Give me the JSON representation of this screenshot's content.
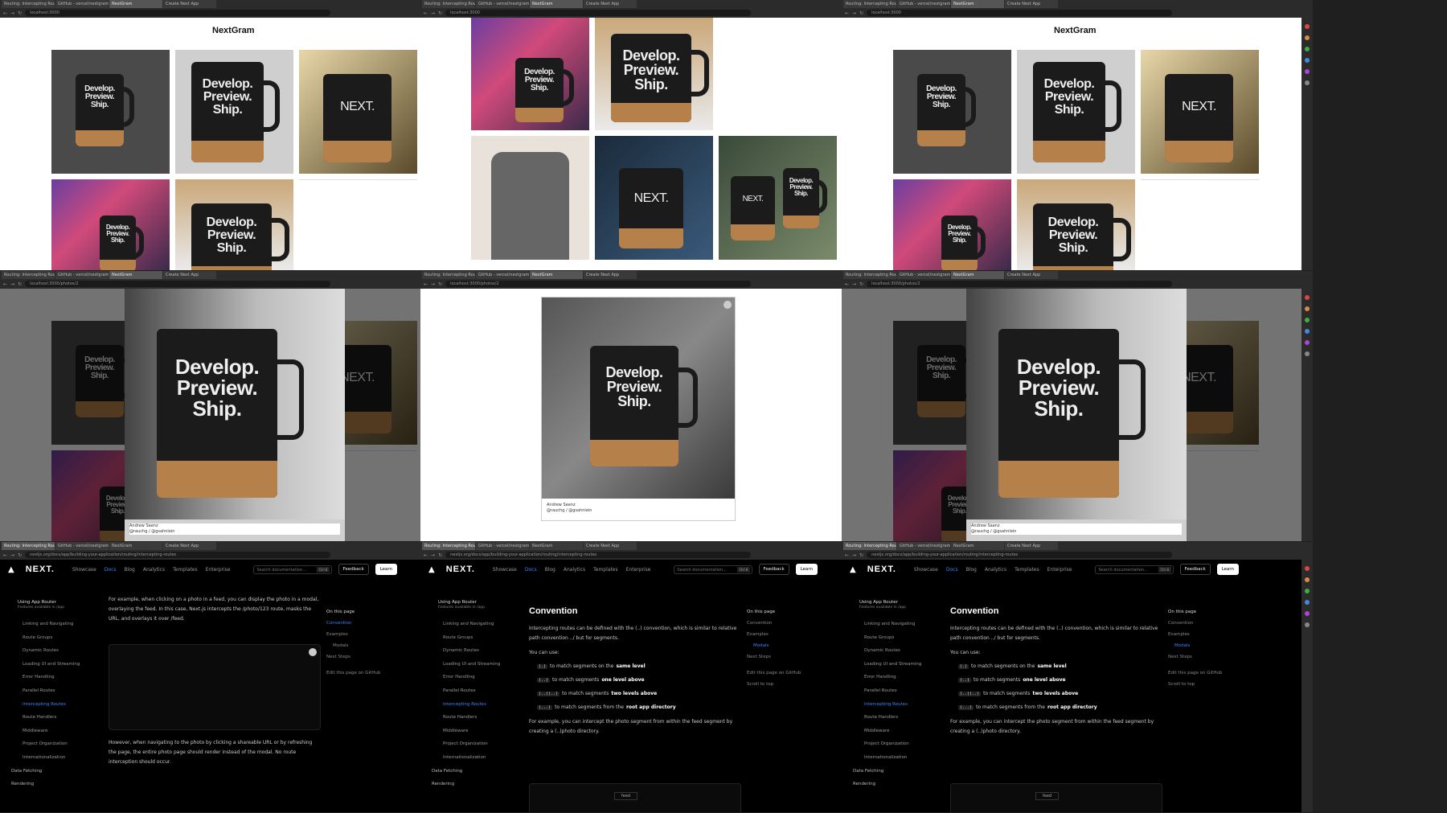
{
  "tabs": [
    "Routing: Intercepting Routes",
    "GitHub - vercel/nextgram",
    "NextGram",
    "Create Next App"
  ],
  "addresses": {
    "localhost": "localhost:3000",
    "photo": "localhost:3000/photos/2",
    "docs": "nextjs.org/docs/app/building-your-application/routing/intercepting-routes"
  },
  "gallery": {
    "title": "NextGram"
  },
  "mug_text": {
    "line1": "Develop.",
    "line2": "Preview.",
    "line3": "Ship."
  },
  "next_logo_text": "NEXT.",
  "photo_caption": {
    "author": "Andrew Saenz",
    "handle": "@rauchg / @gsahnlein"
  },
  "docs": {
    "logo": "NEXT.",
    "nav": [
      "Showcase",
      "Docs",
      "Blog",
      "Analytics",
      "Templates",
      "Enterprise"
    ],
    "active_nav": "Docs",
    "search_placeholder": "Search documentation...",
    "search_kbd": "Ctrl K",
    "feedback": "Feedback",
    "learn": "Learn",
    "sidebar": {
      "section_title": "Using App Router",
      "section_sub": "Features available in /app",
      "items": [
        "Linking and Navigating",
        "Route Groups",
        "Dynamic Routes",
        "Loading UI and Streaming",
        "Error Handling",
        "Parallel Routes",
        "Intercepting Routes",
        "Route Handlers",
        "Middleware",
        "Project Organization",
        "Internationalization"
      ],
      "active_item": "Intercepting Routes",
      "groups": [
        "Data Fetching",
        "Rendering"
      ]
    },
    "toc": {
      "title": "On this page",
      "items": [
        "Convention",
        "Examples",
        "Modals",
        "Next Steps"
      ],
      "edit": "Edit this page on GitHub",
      "scroll": "Scroll to top"
    },
    "panel1_text": {
      "p1": "For example, when clicking on a photo in a feed, you can display the photo in a modal, overlaying the feed. In this case, Next.js intercepts the /photo/123 route, masks the URL, and overlays it over /feed.",
      "p2": "However, when navigating to the photo by clicking a shareable URL or by refreshing the page, the entire photo page should render instead of the modal. No route interception should occur."
    },
    "convention": {
      "heading": "Convention",
      "intro": "Intercepting routes can be defined with the (..) convention, which is similar to relative path convention ../ but for segments.",
      "you_can_use": "You can use:",
      "items": [
        {
          "code": "(.)",
          "text": "to match segments on the",
          "bold": "same level"
        },
        {
          "code": "(..)",
          "text": "to match segments",
          "bold": "one level above"
        },
        {
          "code": "(..)(..)",
          "text": "to match segments",
          "bold": "two levels above"
        },
        {
          "code": "(...)",
          "text": "to match segments from the",
          "bold": "root app directory"
        }
      ],
      "example": "For example, you can intercept the photo segment from within the feed segment by creating a (..)photo directory.",
      "figure_label": "feed"
    }
  },
  "colors": {
    "accent": "#3b82f6",
    "dark_bg": "#000000",
    "chrome": "#2b2b2b"
  }
}
